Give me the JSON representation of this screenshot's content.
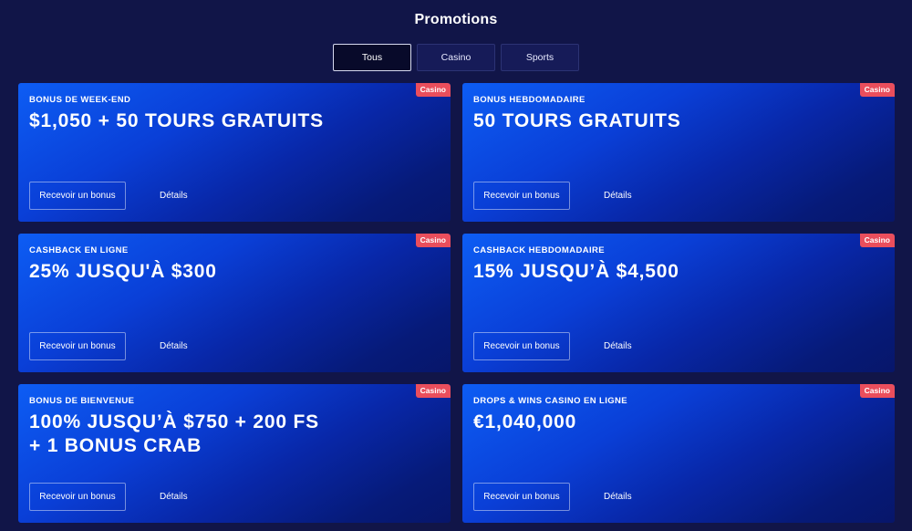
{
  "page": {
    "title": "Promotions"
  },
  "tabs": [
    {
      "label": "Tous",
      "active": true
    },
    {
      "label": "Casino",
      "active": false
    },
    {
      "label": "Sports",
      "active": false
    }
  ],
  "cards": [
    {
      "badge": "Casino",
      "subtitle": "BONUS DE WEEK-END",
      "headline": "$1,050 + 50 TOURS GRATUITS",
      "claim_label": "Recevoir un bonus",
      "details_label": "Détails"
    },
    {
      "badge": "Casino",
      "subtitle": "BONUS HEBDOMADAIRE",
      "headline": "50 TOURS GRATUITS",
      "claim_label": "Recevoir un bonus",
      "details_label": "Détails"
    },
    {
      "badge": "Casino",
      "subtitle": "CASHBACK EN LIGNE",
      "headline": "25% JUSQU'À $300",
      "claim_label": "Recevoir un bonus",
      "details_label": "Détails"
    },
    {
      "badge": "Casino",
      "subtitle": "CASHBACK HEBDOMADAIRE",
      "headline": "15% JUSQU’À $4,500",
      "claim_label": "Recevoir un bonus",
      "details_label": "Détails"
    },
    {
      "badge": "Casino",
      "subtitle": "BONUS DE BIENVENUE",
      "headline": "100% JUSQU’À $750 + 200 FS + 1 BONUS CRAB",
      "claim_label": "Recevoir un bonus",
      "details_label": "Détails"
    },
    {
      "badge": "Casino",
      "subtitle": "DROPS & WINS CASINO EN LIGNE",
      "headline": "€1,040,000",
      "claim_label": "Recevoir un bonus",
      "details_label": "Détails"
    }
  ],
  "colors": {
    "background": "#111548",
    "card_gradient_start": "#0d5df4",
    "card_gradient_end": "#07166a",
    "badge": "#ea4e5c"
  }
}
